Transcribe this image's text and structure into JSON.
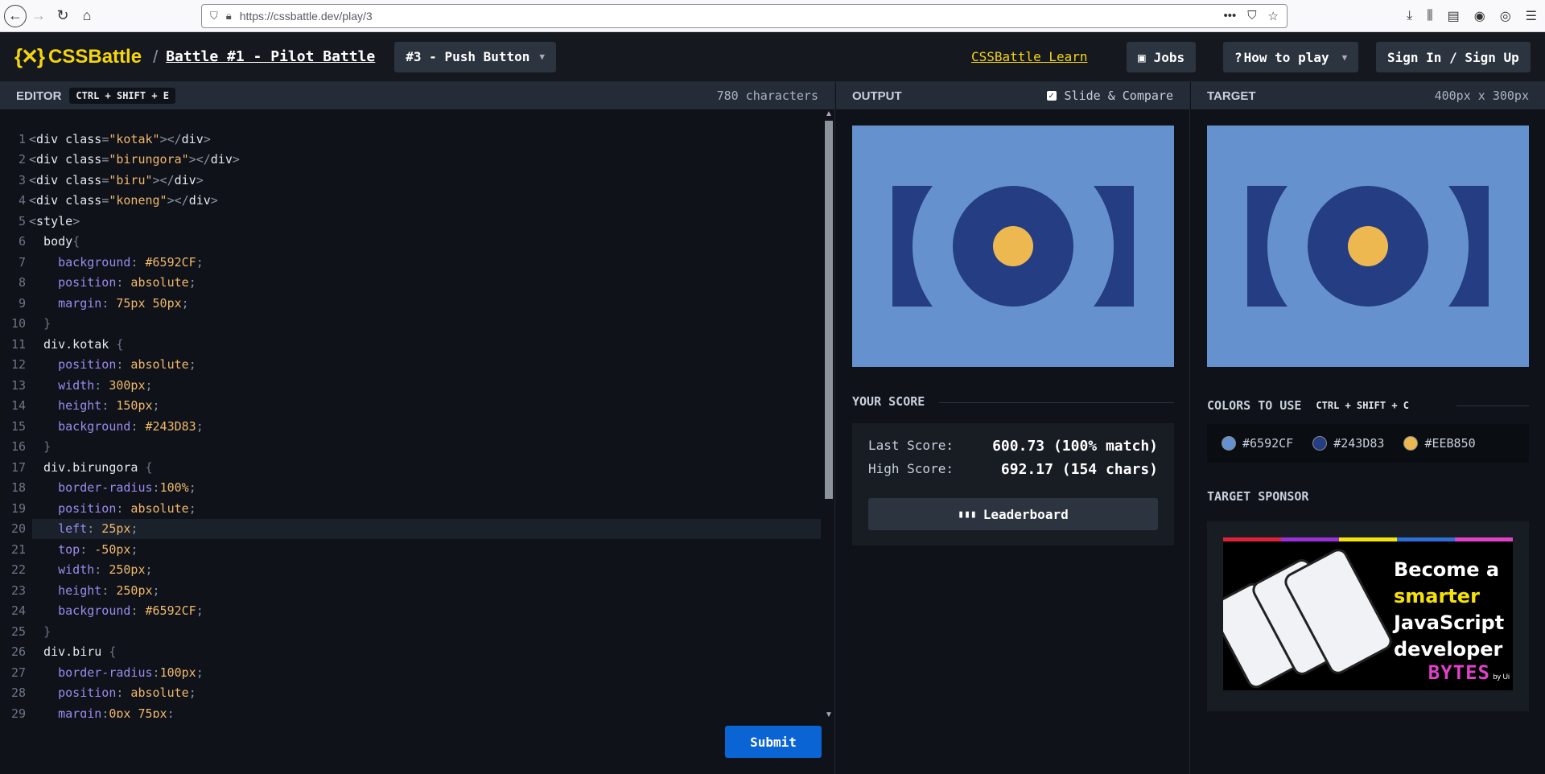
{
  "browser": {
    "url": "https://cssbattle.dev/play/3"
  },
  "header": {
    "logo_text": "CSSBattle",
    "separator": "/",
    "battle_title": "Battle #1 - Pilot Battle",
    "level_select": "#3 - Push Button",
    "learn_link": "CSSBattle Learn",
    "jobs_label": "Jobs",
    "how_to_play_label": "How to play",
    "sign_in_label": "Sign In / Sign Up"
  },
  "editor": {
    "title": "EDITOR",
    "shortcut": "CTRL + SHIFT + E",
    "char_count": "780 characters",
    "submit_label": "Submit",
    "lines": [
      {
        "n": "1",
        "t": "<div class=\"kotak\"></div>"
      },
      {
        "n": "2",
        "t": "<div class=\"birungora\"></div>"
      },
      {
        "n": "3",
        "t": "<div class=\"biru\"></div>"
      },
      {
        "n": "4",
        "t": "<div class=\"koneng\"></div>"
      },
      {
        "n": "5",
        "t": "<style>"
      },
      {
        "n": "6",
        "t": "  body{"
      },
      {
        "n": "7",
        "t": "    background: #6592CF;"
      },
      {
        "n": "8",
        "t": "    position: absolute;"
      },
      {
        "n": "9",
        "t": "    margin: 75px 50px;"
      },
      {
        "n": "10",
        "t": "  }"
      },
      {
        "n": "11",
        "t": "  div.kotak {"
      },
      {
        "n": "12",
        "t": "    position: absolute;"
      },
      {
        "n": "13",
        "t": "    width: 300px;"
      },
      {
        "n": "14",
        "t": "    height: 150px;"
      },
      {
        "n": "15",
        "t": "    background: #243D83;"
      },
      {
        "n": "16",
        "t": "  }"
      },
      {
        "n": "17",
        "t": "  div.birungora {"
      },
      {
        "n": "18",
        "t": "    border-radius:100%;"
      },
      {
        "n": "19",
        "t": "    position: absolute;"
      },
      {
        "n": "20",
        "t": "    left: 25px;"
      },
      {
        "n": "21",
        "t": "    top: -50px;"
      },
      {
        "n": "22",
        "t": "    width: 250px;"
      },
      {
        "n": "23",
        "t": "    height: 250px;"
      },
      {
        "n": "24",
        "t": "    background: #6592CF;"
      },
      {
        "n": "25",
        "t": "  }"
      },
      {
        "n": "26",
        "t": "  div.biru {"
      },
      {
        "n": "27",
        "t": "    border-radius:100px;"
      },
      {
        "n": "28",
        "t": "    position: absolute;"
      },
      {
        "n": "29",
        "t": "    margin:0px 75px;"
      }
    ],
    "active_line": "20"
  },
  "output": {
    "title": "OUTPUT",
    "slide_compare_label": "Slide & Compare",
    "slide_compare_checked": true
  },
  "target": {
    "title": "TARGET",
    "dimensions": "400px x 300px"
  },
  "score": {
    "title": "YOUR SCORE",
    "last_label": "Last Score:",
    "last_value": "600.73 (100% match)",
    "high_label": "High Score:",
    "high_value": "692.17 (154 chars)",
    "leaderboard_label": "Leaderboard"
  },
  "colors": {
    "title": "COLORS TO USE",
    "shortcut": "CTRL + SHIFT + C",
    "swatches": [
      "#6592CF",
      "#243D83",
      "#EEB850"
    ]
  },
  "sponsor": {
    "title": "TARGET SPONSOR",
    "line1": "Become a",
    "line2": "smarter",
    "line3": "JavaScript",
    "line4": "developer",
    "brand": "BYTES",
    "by": "by Ui"
  },
  "theme": {
    "accent_yellow": "#f5d50b",
    "submit_blue": "#0a64d4"
  }
}
